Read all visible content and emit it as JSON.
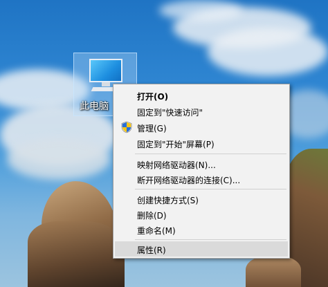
{
  "desktop": {
    "icon": {
      "label": "此电脑",
      "icon": "computer-icon"
    }
  },
  "context_menu": {
    "items": [
      {
        "label": "打开(O)",
        "bold": true
      },
      {
        "label": "固定到\"快速访问\""
      },
      {
        "label": "管理(G)",
        "icon": "uac-shield-icon"
      },
      {
        "label": "固定到\"开始\"屏幕(P)"
      },
      {
        "label": "映射网络驱动器(N)..."
      },
      {
        "label": "断开网络驱动器的连接(C)..."
      },
      {
        "label": "创建快捷方式(S)"
      },
      {
        "label": "删除(D)"
      },
      {
        "label": "重命名(M)"
      },
      {
        "label": "属性(R)",
        "highlighted": true
      }
    ]
  },
  "colors": {
    "menu_background": "#f2f2f2",
    "menu_highlight": "#dadada",
    "menu_border": "#a0a0a0"
  }
}
